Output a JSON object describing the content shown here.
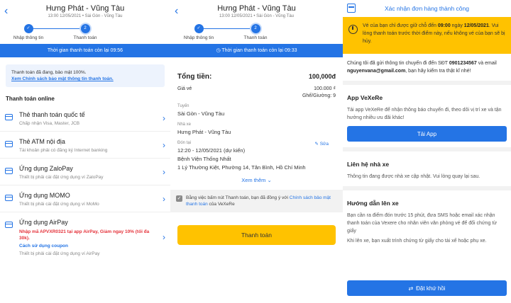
{
  "checkout": {
    "route_title": "Hưng Phát - Vũng Tàu",
    "route_subtitle": "13:00 12/05/2021 • Sài Gòn - Vũng Tàu",
    "step1_label": "Nhập thông tin",
    "step2_label": "Thanh toán",
    "step2_num": "2"
  },
  "panel1": {
    "timer_text": "Thời gian thanh toán còn lại 09:56",
    "secure_text": "Thanh toán đã đang, bảo mật 100%.",
    "secure_link": "Xem Chính sách bảo mật thông tin thanh toán.",
    "section_title": "Thanh toán online",
    "methods": [
      {
        "title": "Thẻ thanh toán quốc tế",
        "desc": "Chấp nhận Visa, Master, JCB"
      },
      {
        "title": "Thẻ ATM nội địa",
        "desc": "Tài khoản phải có đăng ký Internet banking"
      },
      {
        "title": "Ứng dụng ZaloPay",
        "desc": "Thiết bị phải cài đặt ứng dụng ví ZaloPay"
      },
      {
        "title": "Ứng dụng MOMO",
        "desc": "Thiết bị phải cài đặt ứng dụng ví MoMo"
      }
    ],
    "airpay": {
      "title": "Ứng dụng AirPay",
      "promo": "Nhập mã APVXR0321 tại app AirPay, Giảm ngay 10% (tối đa 30k).",
      "link": "Cách sử dụng coupon",
      "desc": "Thiết bị phải cài đặt ứng dụng ví AirPay"
    }
  },
  "panel2": {
    "timer_text": "Thời gian thanh toán còn lại 09:33",
    "total_label": "Tổng tiền:",
    "total_value": "100,000đ",
    "fare_label": "Giá vé",
    "fare_value": "100.000 ₫",
    "seat_text": "Ghế/Giường: 9",
    "route_label": "Tuyến",
    "route_value": "Sài Gòn - Vũng Tàu",
    "operator_label": "Nhà xe",
    "operator_value": "Hưng Phát - Vũng Tàu",
    "pickup_label": "Đón tại",
    "edit_link": "Sửa",
    "pickup_time": "12:20 - 12/05/2021 (dự kiến)",
    "pickup_place": "Bệnh Viện Thống Nhất",
    "pickup_address": "1 Lý Thường Kiệt, Phường 14, Tân Bình, Hồ Chí Minh",
    "more_link": "Xem thêm",
    "agree_prefix": "Bằng việc bấm nút Thanh toán, bạn đã đồng ý với ",
    "agree_link": "Chính sách bảo mật thanh toán",
    "agree_suffix": " của VeXeRe",
    "pay_button": "Thanh toán"
  },
  "panel3": {
    "header_title": "Xác nhận đơn hàng thành công",
    "warn_prefix": "Vé của bạn chỉ được giữ chỗ đến ",
    "warn_time": "09:00",
    "warn_mid": " ngày ",
    "warn_date": "12/05/2021",
    "warn_suffix": ". Vui lòng thanh toán trước thời điểm này, nếu không vé của bạn sẽ bị hủy.",
    "info_prefix": "Chúng tôi đã gửi thông tin chuyến đi đến SĐT ",
    "info_phone": "0901234567",
    "info_mid": " và email ",
    "info_email": "nguyenvana@gmail.com",
    "info_suffix": ", bạn hãy kiểm tra thật kĩ nhé!",
    "app_title": "App VeXeRe",
    "app_text": "Tải app VeXeRe để nhận thông báo chuyến đi, theo dõi vị trí xe và tận hưởng nhiều ưu đãi khác!",
    "app_button": "Tải App",
    "contact_title": "Liên hệ nhà xe",
    "contact_text": "Thông tin đang được nhà xe cập nhật. Vui lòng quay lại sau.",
    "guide_title": "Hướng dẫn lên xe",
    "guide_text1": "Bạn cần ra điểm đón trước 15 phút, đưa SMS hoặc email xác nhận thanh toán của Vexere cho nhân viên văn phòng vé để đổi chứng từ giấy",
    "guide_text2": "Khi lên xe, bạn xuất trình chứng từ giấy cho tài xế hoặc phụ xe.",
    "return_button": "Đặt khứ hồi"
  }
}
